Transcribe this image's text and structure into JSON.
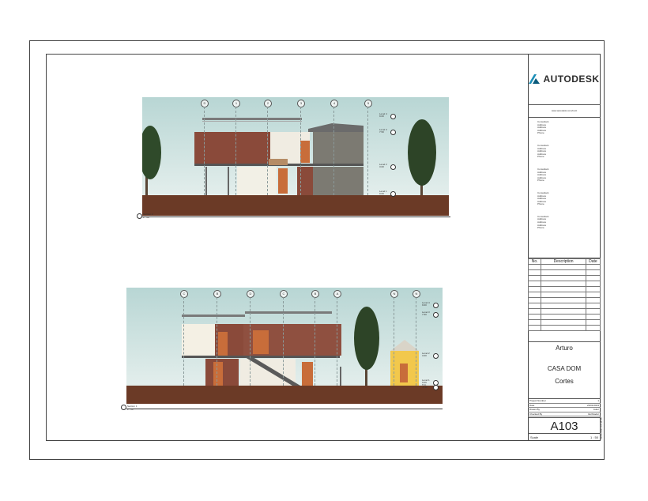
{
  "titleblock": {
    "logo_text": "AUTODESK",
    "url": "www.autodesk.com/revit",
    "consultants": [
      {
        "title": "Consultant",
        "lines": [
          "Address",
          "Address",
          "Address",
          "Phone"
        ]
      },
      {
        "title": "Consultant",
        "lines": [
          "Address",
          "Address",
          "Address",
          "Phone"
        ]
      },
      {
        "title": "Consultant",
        "lines": [
          "Address",
          "Address",
          "Address",
          "Phone"
        ]
      },
      {
        "title": "Consultant",
        "lines": [
          "Address",
          "Address",
          "Address",
          "Phone"
        ]
      },
      {
        "title": "Consultant",
        "lines": [
          "Address",
          "Address",
          "Address",
          "Phone"
        ]
      }
    ],
    "revision_headers": {
      "no": "No.",
      "description": "Description",
      "date": "Date"
    },
    "revision_rows": 12,
    "owner": "Arturo",
    "project": "CASA DOM",
    "sheet_name": "Cortes",
    "meta": [
      {
        "label": "Project Number",
        "value": "1"
      },
      {
        "label": "Date",
        "value": "23/01/2023"
      },
      {
        "label": "Drawn By",
        "value": "Autor"
      },
      {
        "label": "Checked By",
        "value": "Verificador"
      }
    ],
    "sheet_number": "A103",
    "scale_label": "Scale",
    "scale_value": "1 : 50",
    "side_stamp": "23/01/2023 18:38:55"
  },
  "section_a": {
    "grid_labels": [
      "D",
      "1",
      "2",
      "3",
      "4",
      "5"
    ],
    "levels": [
      {
        "name": "Level 4",
        "elev": "9.00"
      },
      {
        "name": "Level 3",
        "elev": "7.50"
      },
      {
        "name": "Level 2",
        "elev": "3.00"
      },
      {
        "name": "Level 1",
        "elev": "0.00"
      }
    ],
    "caption": "Section 2",
    "caption_scale": "1 : 50"
  },
  "section_b": {
    "grid_labels": [
      "C",
      "B",
      "D",
      "C",
      "B",
      "A",
      "N",
      "N"
    ],
    "levels": [
      {
        "name": "Level 4",
        "elev": "9.00"
      },
      {
        "name": "Level 3",
        "elev": "7.50"
      },
      {
        "name": "Level 2",
        "elev": "3.00"
      },
      {
        "name": "Level 1",
        "elev": "0.00"
      },
      {
        "name": "T.O.",
        "elev": "-0.20"
      }
    ],
    "caption": "Section 1",
    "caption_scale": "1 : 50"
  }
}
